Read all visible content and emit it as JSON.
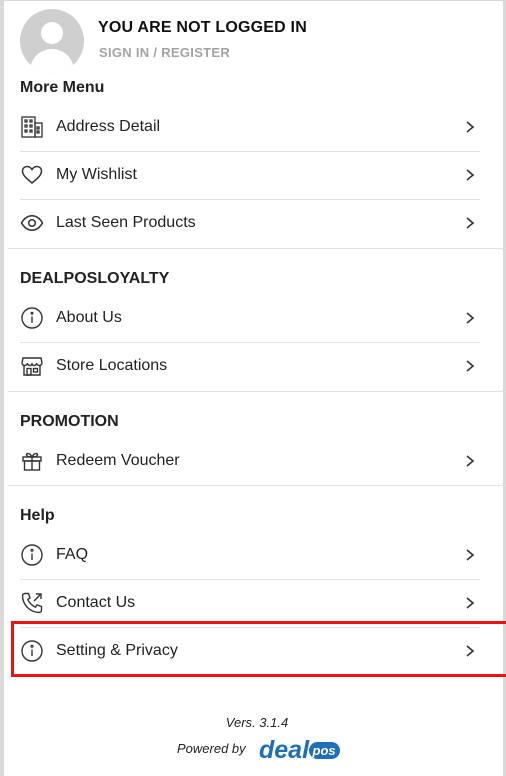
{
  "header": {
    "title": "YOU ARE NOT LOGGED IN",
    "subtitle": "SIGN IN / REGISTER"
  },
  "sections": [
    {
      "title": "More Menu",
      "items": [
        {
          "label": "Address Detail",
          "icon": "building-icon"
        },
        {
          "label": "My Wishlist",
          "icon": "heart-icon"
        },
        {
          "label": "Last Seen Products",
          "icon": "eye-icon"
        }
      ]
    },
    {
      "title": "DEALPOSLOYALTY",
      "items": [
        {
          "label": "About Us",
          "icon": "info-icon"
        },
        {
          "label": "Store Locations",
          "icon": "store-icon"
        }
      ]
    },
    {
      "title": "PROMOTION",
      "items": [
        {
          "label": "Redeem Voucher",
          "icon": "gift-icon"
        }
      ]
    },
    {
      "title": "Help",
      "items": [
        {
          "label": "FAQ",
          "icon": "info-icon"
        },
        {
          "label": "Contact Us",
          "icon": "phone-icon"
        },
        {
          "label": "Setting & Privacy",
          "icon": "info-icon"
        }
      ]
    }
  ],
  "footer": {
    "version": "Vers. 3.1.4",
    "powered_by": "Powered by",
    "logo_text": "dealpos"
  },
  "colors": {
    "highlight": "#ee1111",
    "logo_blue": "#1e6fb8",
    "logo_light": "#6aa7e0"
  }
}
